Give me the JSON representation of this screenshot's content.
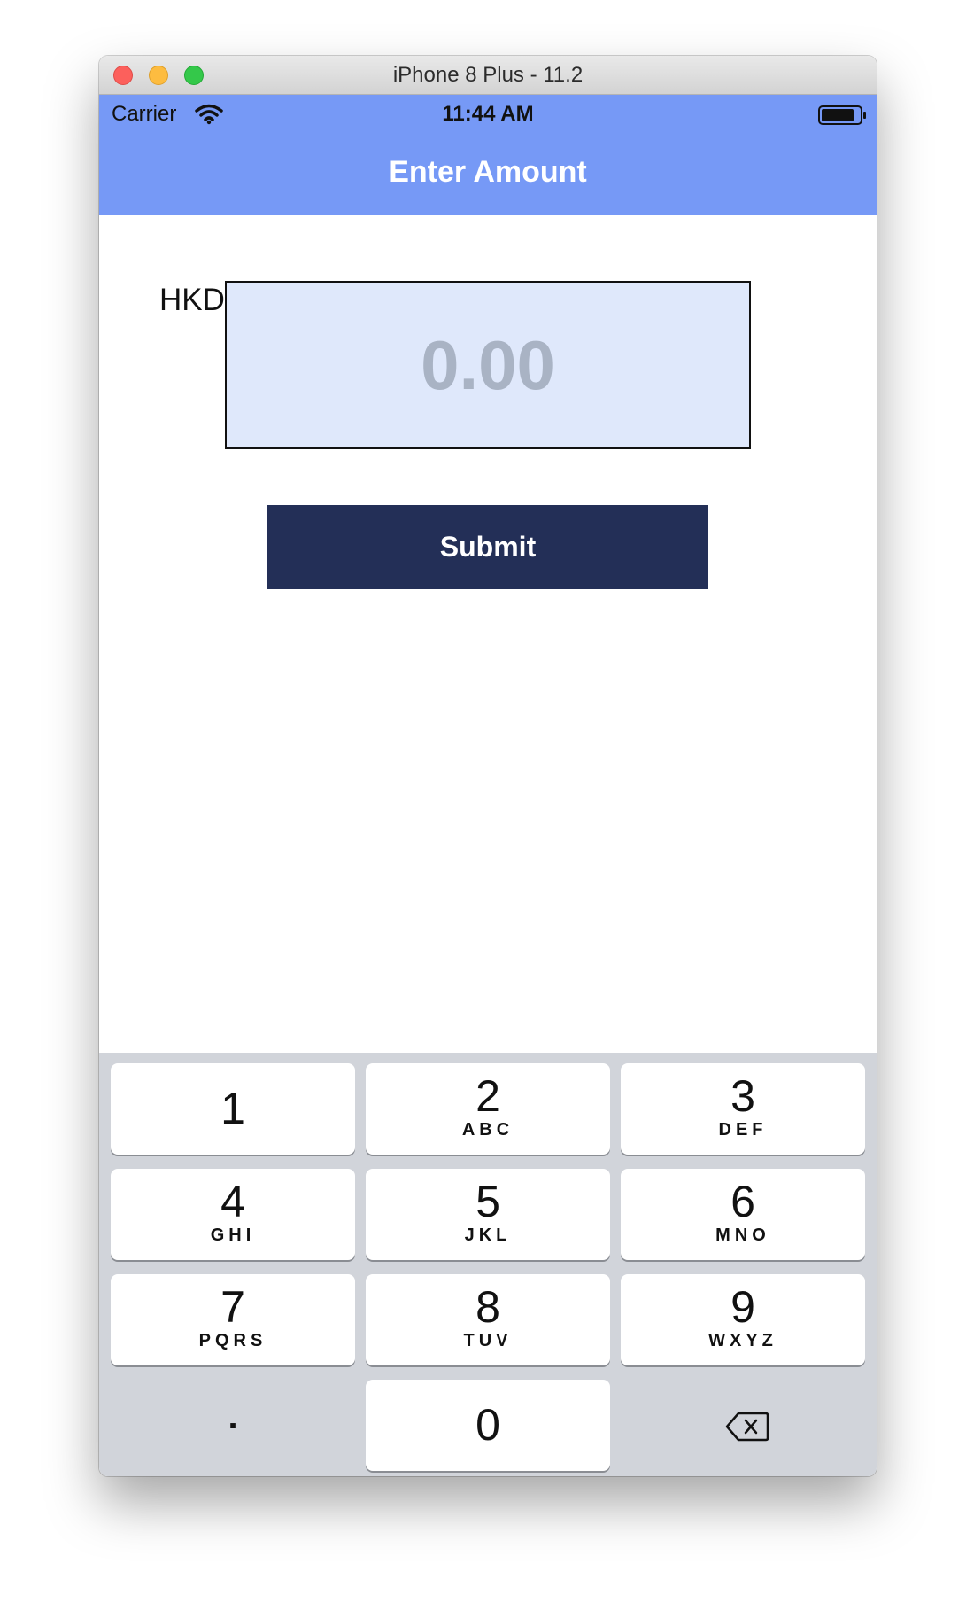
{
  "window": {
    "title": "iPhone 8 Plus - 11.2"
  },
  "status_bar": {
    "carrier": "Carrier",
    "time": "11:44 AM"
  },
  "nav": {
    "title": "Enter Amount"
  },
  "form": {
    "currency": "HKD",
    "amount_placeholder": "0.00",
    "submit_label": "Submit"
  },
  "keypad": {
    "keys": [
      {
        "digit": "1",
        "letters": ""
      },
      {
        "digit": "2",
        "letters": "ABC"
      },
      {
        "digit": "3",
        "letters": "DEF"
      },
      {
        "digit": "4",
        "letters": "GHI"
      },
      {
        "digit": "5",
        "letters": "JKL"
      },
      {
        "digit": "6",
        "letters": "MNO"
      },
      {
        "digit": "7",
        "letters": "PQRS"
      },
      {
        "digit": "8",
        "letters": "TUV"
      },
      {
        "digit": "9",
        "letters": "WXYZ"
      }
    ],
    "dot_label": ".",
    "zero_digit": "0"
  },
  "colors": {
    "nav_background": "#7699f6",
    "amount_field_background": "#dfe8fb",
    "submit_background": "#232f57",
    "keypad_background": "#d1d4da"
  }
}
